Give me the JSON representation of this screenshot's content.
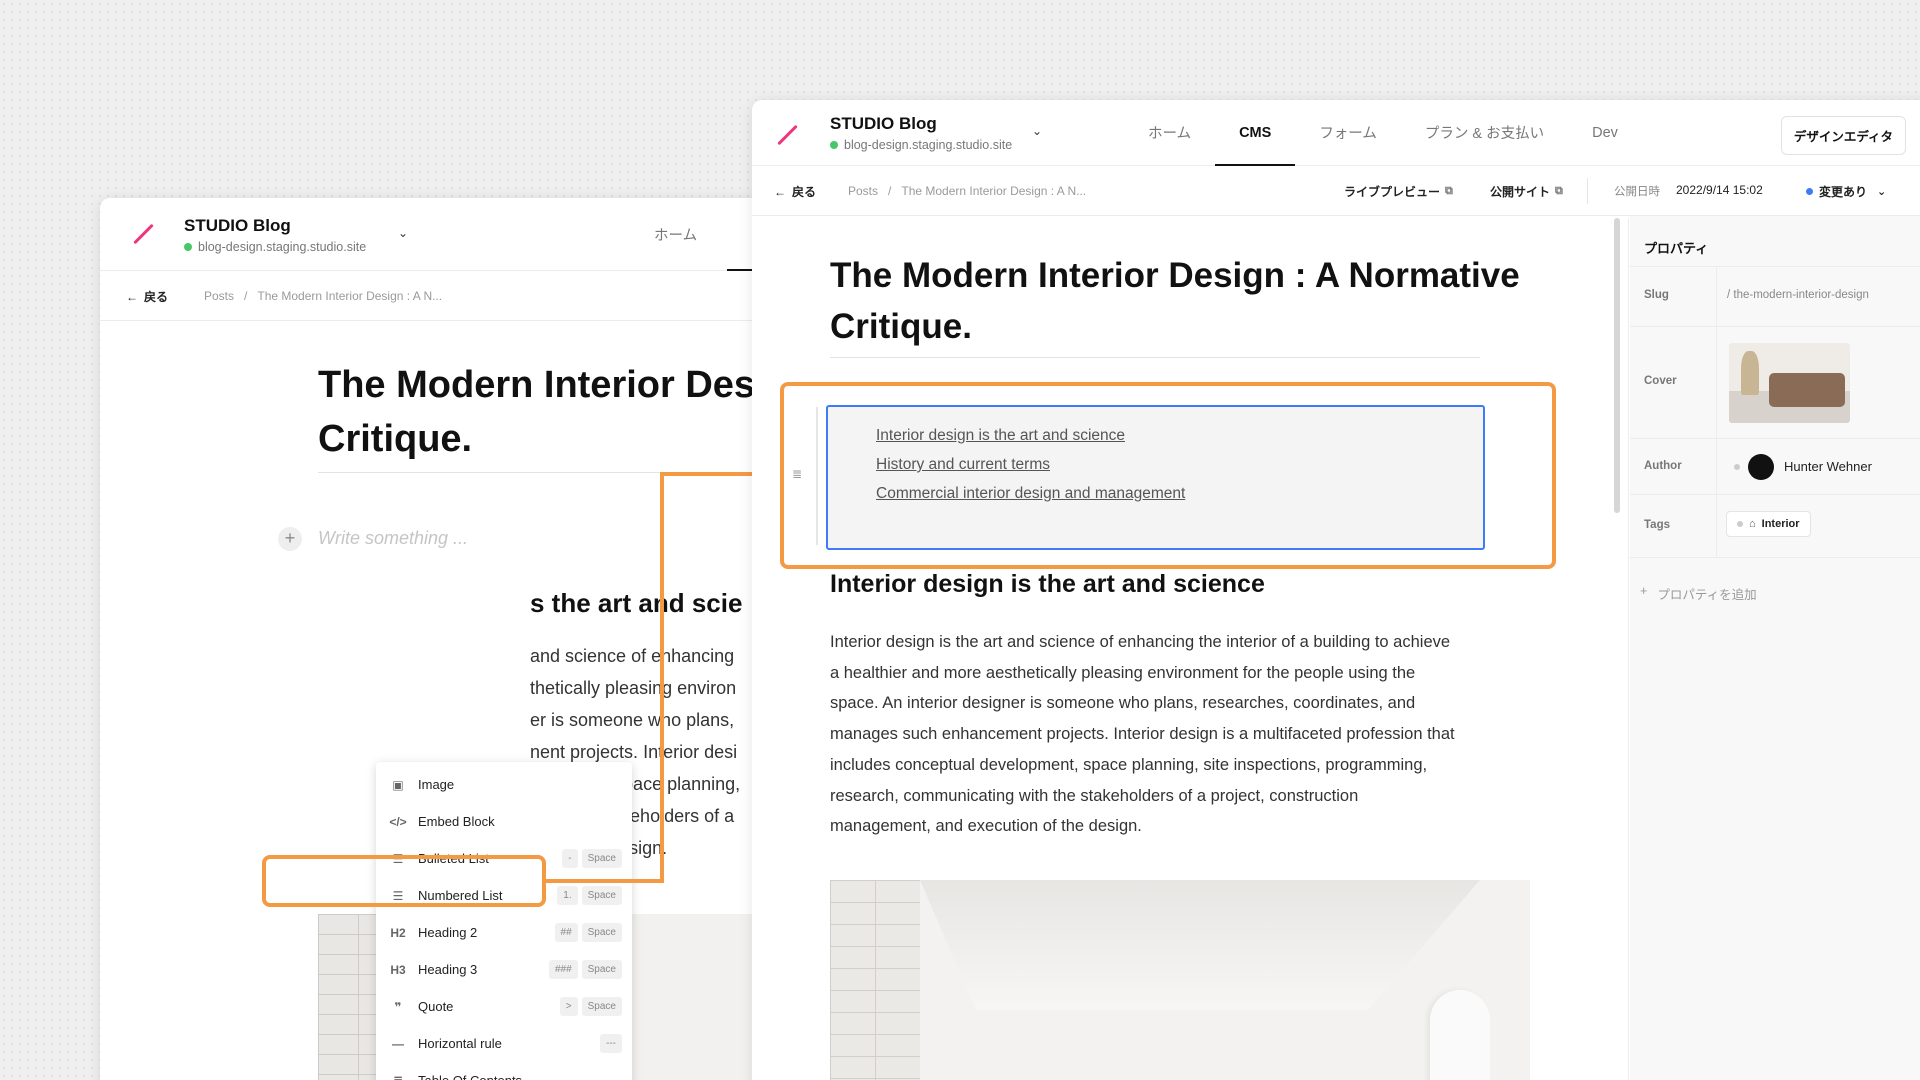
{
  "back_window": {
    "site_title": "STUDIO Blog",
    "site_domain": "blog-design.staging.studio.site",
    "nav_tab": "ホーム",
    "back_label": "戻る",
    "breadcrumb_root": "Posts",
    "breadcrumb_sep": "/",
    "breadcrumb_current": "The Modern Interior Design : A N...",
    "title_line1": "The Modern Interior Desi",
    "title_line2": "Critique.",
    "placeholder": "Write something ...",
    "heading_fragment": "s the art and scie",
    "paragraph_lines": [
      "and science of enhancing",
      "thetically pleasing environ",
      "er is someone who plans,",
      "nent projects. Interior desi",
      "elopment, space planning,",
      "with the stakeholders of a",
      "ion of the design."
    ]
  },
  "insert_menu": {
    "items": [
      {
        "icon": "▣",
        "label": "Image",
        "keys": []
      },
      {
        "icon": "</>",
        "label": "Embed Block",
        "keys": []
      },
      {
        "icon": "☰",
        "label": "Bulleted List",
        "keys": [
          "-",
          "Space"
        ]
      },
      {
        "icon": "☰",
        "label": "Numbered List",
        "keys": [
          "1.",
          "Space"
        ]
      },
      {
        "icon": "H2",
        "label": "Heading 2",
        "keys": [
          "##",
          "Space"
        ]
      },
      {
        "icon": "H3",
        "label": "Heading 3",
        "keys": [
          "###",
          "Space"
        ]
      },
      {
        "icon": "❞",
        "label": "Quote",
        "keys": [
          ">",
          "Space"
        ]
      },
      {
        "icon": "—",
        "label": "Horizontal rule",
        "keys": [
          "---"
        ]
      },
      {
        "icon": "≣",
        "label": "Table Of Contents",
        "keys": []
      }
    ]
  },
  "front_window": {
    "site_title": "STUDIO Blog",
    "site_domain": "blog-design.staging.studio.site",
    "nav_tabs": [
      "ホーム",
      "CMS",
      "フォーム",
      "プラン & お支払い",
      "Dev"
    ],
    "active_tab": "CMS",
    "design_editor_button": "デザインエディタ",
    "back_label": "戻る",
    "breadcrumb_root": "Posts",
    "breadcrumb_sep": "/",
    "breadcrumb_current": "The Modern Interior Design : A N...",
    "live_preview": "ライブプレビュー",
    "public_site": "公開サイト",
    "publish_date_label": "公開日時",
    "publish_date_value": "2022/9/14 15:02",
    "status": "変更あり",
    "title_line1": "The Modern Interior Design : A Normative",
    "title_line2": "Critique.",
    "toc_links": [
      "Interior design is the art and science",
      "History and current terms",
      "Commercial interior design and management"
    ],
    "heading": "Interior design is the art and science",
    "paragraph_lines": [
      "Interior design is the art and science of enhancing the interior of a building to achieve",
      "a healthier and more aesthetically pleasing environment for the people using the",
      "space. An interior designer is someone who plans, researches, coordinates, and",
      "manages such enhancement projects. Interior design is a multifaceted profession that",
      "includes conceptual development, space planning, site inspections, programming,",
      "research, communicating with the stakeholders of a project, construction",
      "management, and execution of the design."
    ]
  },
  "properties": {
    "title": "プロパティ",
    "slug_label": "Slug",
    "slug_value": "/ the-modern-interior-design",
    "cover_label": "Cover",
    "author_label": "Author",
    "author_name": "Hunter Wehner",
    "tags_label": "Tags",
    "tag_value": "Interior",
    "add_property": "プロパティを追加"
  },
  "colors": {
    "highlight": "#f39a43",
    "selection": "#3e7bfa",
    "brand": "#f0357d",
    "online": "#47c76a"
  }
}
